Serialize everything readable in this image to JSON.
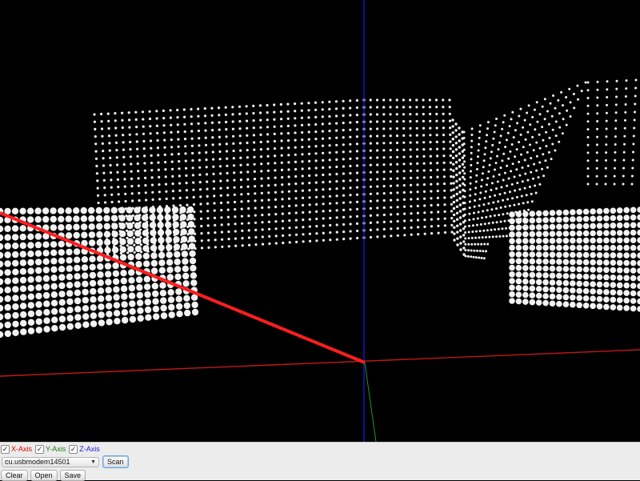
{
  "axes": {
    "x": {
      "label": "X-Axis",
      "checked": true,
      "color": "#e00000"
    },
    "y": {
      "label": "Y-Axis",
      "checked": true,
      "color": "#1a7a1a"
    },
    "z": {
      "label": "Z-Axis",
      "checked": true,
      "color": "#2020d0"
    }
  },
  "checkmark": "✓",
  "port": {
    "selected": "cu.usbmodem14501"
  },
  "buttons": {
    "scan": "Scan",
    "clear": "Clear",
    "open": "Open",
    "save": "Save"
  },
  "viewport": {
    "background": "#000000",
    "point_color": "#f2f2f2",
    "axis_colors": {
      "x": "#ff2020",
      "y": "#1a9a1a",
      "z": "#1a1aff"
    }
  }
}
